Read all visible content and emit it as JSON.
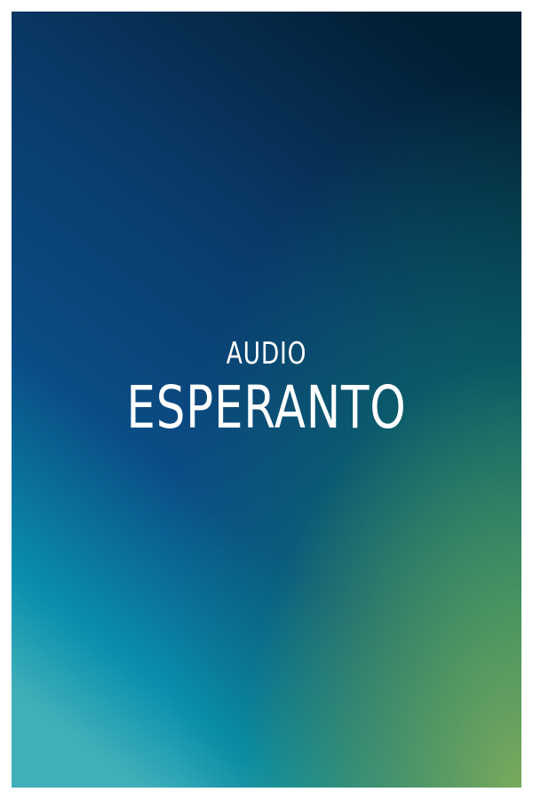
{
  "cover": {
    "subtitle": "AUDIO",
    "title": "ESPERANTO"
  },
  "colors": {
    "top_right": "#021f34",
    "upper_left": "#0a3a6a",
    "mid_left": "#0a4d86",
    "lower_left": "#0a8fae",
    "bottom_left": "#40b0b8",
    "mid_right": "#0a7a66",
    "bottom_right": "#78aa5c",
    "text": "#ffffff"
  }
}
